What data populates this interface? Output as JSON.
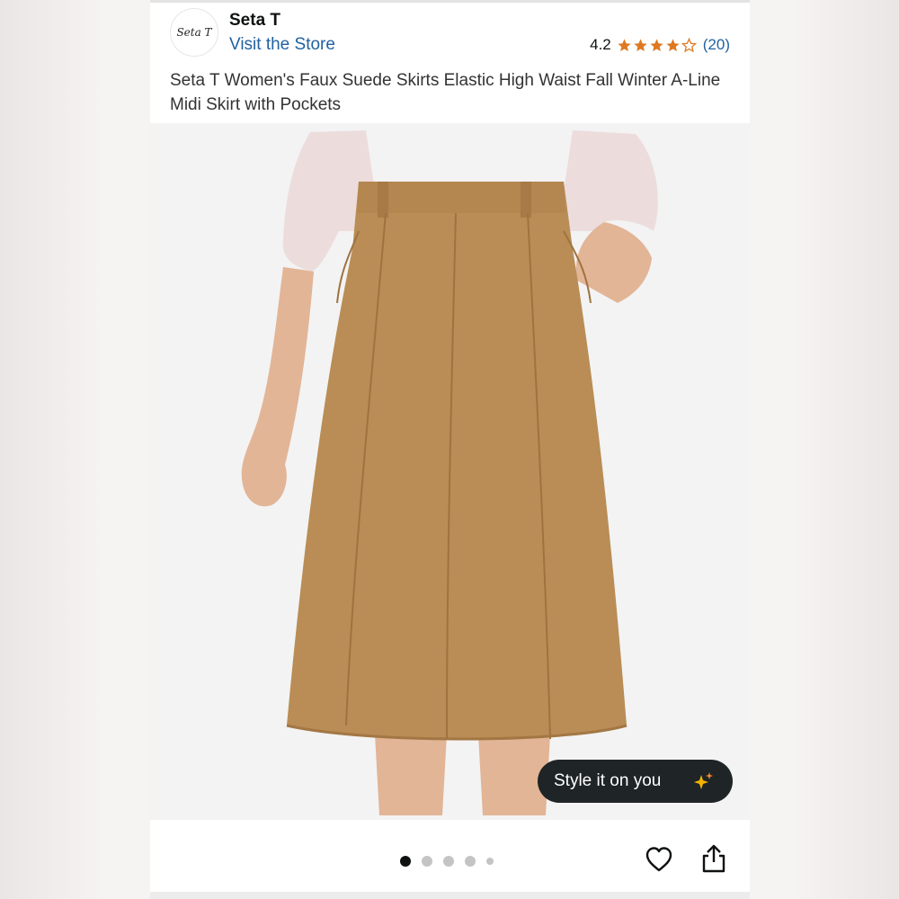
{
  "store": {
    "name": "Seta T",
    "logo_text": "Seta T",
    "visit_label": "Visit the Store"
  },
  "rating": {
    "value": "4.2",
    "stars_filled": 4,
    "stars_total": 5,
    "count": "(20)",
    "star_color": "#de7921"
  },
  "product": {
    "title": "Seta T Women's Faux Suede Skirts Elastic High Waist Fall Winter A-Line Midi Skirt with Pockets",
    "skirt_color": "#b98d55"
  },
  "style_button": {
    "label": "Style it on you",
    "icon": "sparkle-icon"
  },
  "carousel": {
    "total_dots": 5,
    "active_index": 0
  },
  "actions": {
    "favorite_icon": "heart-icon",
    "share_icon": "share-icon"
  },
  "colors": {
    "link": "#2162a1",
    "button_bg": "#1f2426"
  }
}
